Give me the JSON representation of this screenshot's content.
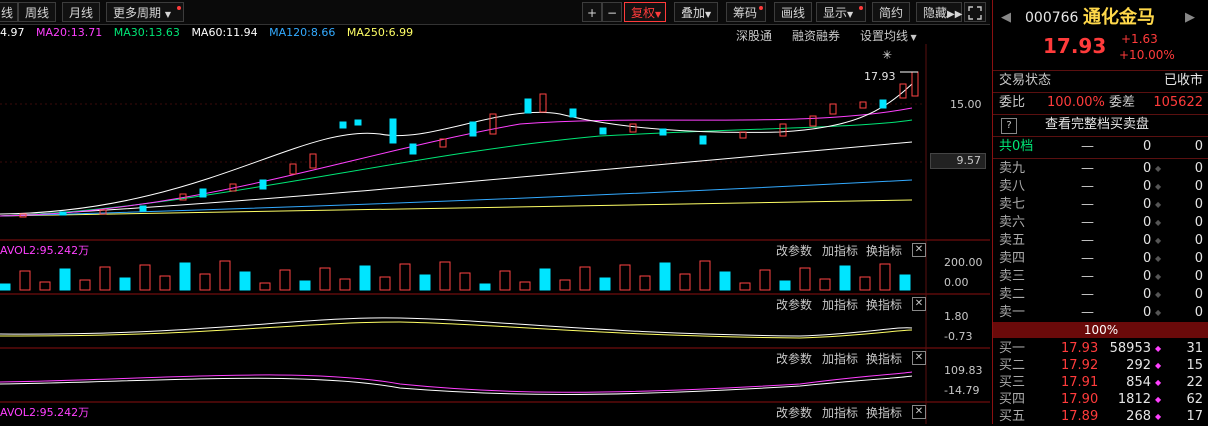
{
  "toolbar": {
    "left_partial": "线",
    "period_week": "周线",
    "period_month": "月线",
    "more_periods": "更多周期",
    "plus": "+",
    "minus": "−",
    "restore_rights": "复权",
    "overlay": "叠加",
    "chips": "筹码",
    "draw_line": "画线",
    "display": "显示",
    "simple": "简约",
    "hide": "隐藏",
    "collapse_icon": "double-chevron-right-icon",
    "fullscreen_icon": "fullscreen-icon"
  },
  "ma_legend": {
    "ma5": "4.97",
    "ma20": "MA20:13.71",
    "ma30": "MA30:13.63",
    "ma60": "MA60:11.94",
    "ma120": "MA120:8.66",
    "ma250": "MA250:6.99",
    "colors": {
      "ma5": "#ffffff",
      "ma20": "#ff40ff",
      "ma30": "#00e676",
      "ma60": "#ffffff",
      "ma120": "#33aaff",
      "ma250": "#ffff66"
    }
  },
  "chart_links": {
    "shenzhen_connect": "深股通",
    "margin_trading": "融资融券",
    "settings_ma": "设置均线"
  },
  "chart_labels": {
    "price_top": "15.00",
    "price_current_box": "9.57",
    "last_price_tag": "17.93",
    "star": "✳"
  },
  "indicators": [
    {
      "label": "AVOL2:95.242万",
      "axis_top": "200.00",
      "axis_bottom": "0.00",
      "change_param": "改参数",
      "add_indicator": "加指标",
      "switch_indicator": "换指标"
    },
    {
      "label": "",
      "axis_top": "1.80",
      "axis_bottom": "-0.73",
      "change_param": "改参数",
      "add_indicator": "加指标",
      "switch_indicator": "换指标"
    },
    {
      "label": "",
      "axis_top": "109.83",
      "axis_bottom": "-14.79",
      "change_param": "改参数",
      "add_indicator": "加指标",
      "switch_indicator": "换指标"
    },
    {
      "label": "AVOL2:95.242万",
      "axis_top": "",
      "axis_bottom": "",
      "change_param": "改参数",
      "add_indicator": "加指标",
      "switch_indicator": "换指标"
    }
  ],
  "sidebar": {
    "code": "000766",
    "name": "通化金马",
    "price": "17.93",
    "change": "+1.63",
    "change_pct": "+10.00%",
    "trade_status_label": "交易状态",
    "trade_status_value": "已收市",
    "ratio_label": "委比",
    "ratio_value": "100.00%",
    "diff_label": "委差",
    "diff_value": "105622",
    "full_book": "查看完整档买卖盘",
    "total_label": "共0档",
    "total_dash": "—",
    "total_v1": "0",
    "total_v2": "0",
    "asks": [
      {
        "label": "卖九",
        "price": "—",
        "vol": "0",
        "cnt": "0"
      },
      {
        "label": "卖八",
        "price": "—",
        "vol": "0",
        "cnt": "0"
      },
      {
        "label": "卖七",
        "price": "—",
        "vol": "0",
        "cnt": "0"
      },
      {
        "label": "卖六",
        "price": "—",
        "vol": "0",
        "cnt": "0"
      },
      {
        "label": "卖五",
        "price": "—",
        "vol": "0",
        "cnt": "0"
      },
      {
        "label": "卖四",
        "price": "—",
        "vol": "0",
        "cnt": "0"
      },
      {
        "label": "卖三",
        "price": "—",
        "vol": "0",
        "cnt": "0"
      },
      {
        "label": "卖二",
        "price": "—",
        "vol": "0",
        "cnt": "0"
      },
      {
        "label": "卖一",
        "price": "—",
        "vol": "0",
        "cnt": "0"
      }
    ],
    "bid_bar_pct": "100%",
    "bids": [
      {
        "label": "买一",
        "price": "17.93",
        "vol": "58953",
        "cnt": "31"
      },
      {
        "label": "买二",
        "price": "17.92",
        "vol": "292",
        "cnt": "15"
      },
      {
        "label": "买三",
        "price": "17.91",
        "vol": "854",
        "cnt": "22"
      },
      {
        "label": "买四",
        "price": "17.90",
        "vol": "1812",
        "cnt": "62"
      },
      {
        "label": "买五",
        "price": "17.89",
        "vol": "268",
        "cnt": "17"
      }
    ]
  }
}
